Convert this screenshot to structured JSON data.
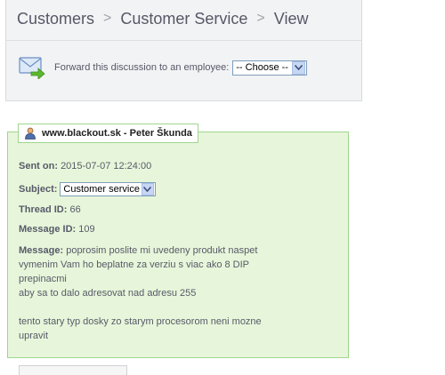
{
  "breadcrumb": {
    "items": [
      "Customers",
      "Customer Service",
      "View"
    ],
    "separator": ">"
  },
  "forward": {
    "label": "Forward this discussion to an employee:",
    "select_value": "-- Choose --"
  },
  "message": {
    "header": "www.blackout.sk - Peter Škunda",
    "sent_on_label": "Sent on:",
    "sent_on_value": "2015-07-07 12:24:00",
    "subject_label": "Subject:",
    "subject_value": "Customer service",
    "thread_id_label": "Thread ID:",
    "thread_id_value": "66",
    "message_id_label": "Message ID:",
    "message_id_value": "109",
    "message_label": "Message:",
    "message_lines": [
      "poprosim poslite mi uvedeny produkt naspet",
      "vymenim Vam ho beplatne za verziu s viac ako 8 DIP",
      "prepinacmi",
      "aby sa to dalo adresovat nad adresu 255",
      "",
      "tento stary typ dosky zo starym procesorom neni mozne",
      "upravit"
    ]
  },
  "colors": {
    "box_bg": "#e7f6da",
    "box_border": "#9fd58f",
    "toolbar_bg": "#f2f3f5"
  },
  "icons": {
    "forward": "mail-forward-icon",
    "user": "user-icon",
    "dropdown": "chevron-down-icon"
  }
}
